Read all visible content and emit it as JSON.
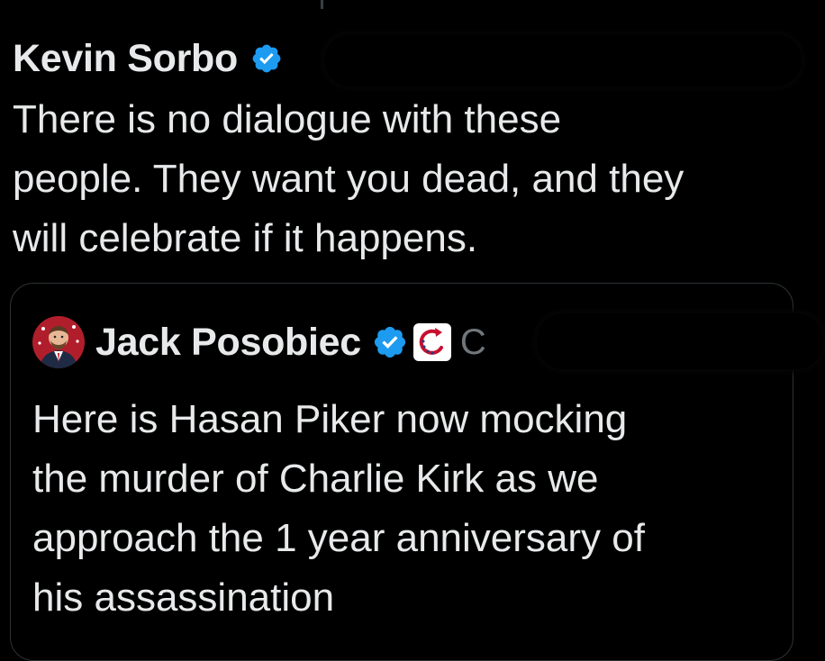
{
  "tweet": {
    "author": "Kevin Sorbo",
    "verified": true,
    "text_lines": [
      "There is no dialogue with these",
      "people. They want you dead, and they",
      "will celebrate if it happens."
    ]
  },
  "quote": {
    "author": "Jack Posobiec",
    "verified": true,
    "handle_visible": "C",
    "text_lines": [
      "Here is Hasan Piker now mocking",
      "the murder of Charlie Kirk as we",
      "approach the 1 year anniversary of",
      "his assassination"
    ]
  },
  "colors": {
    "background": "#000000",
    "text": "#e7e9ea",
    "muted": "#71767b",
    "verified_blue": "#1d9bf0",
    "border": "#2f3336"
  },
  "icons": {
    "verified": "verified-badge-icon",
    "affiliate": "affiliate-badge-icon"
  }
}
